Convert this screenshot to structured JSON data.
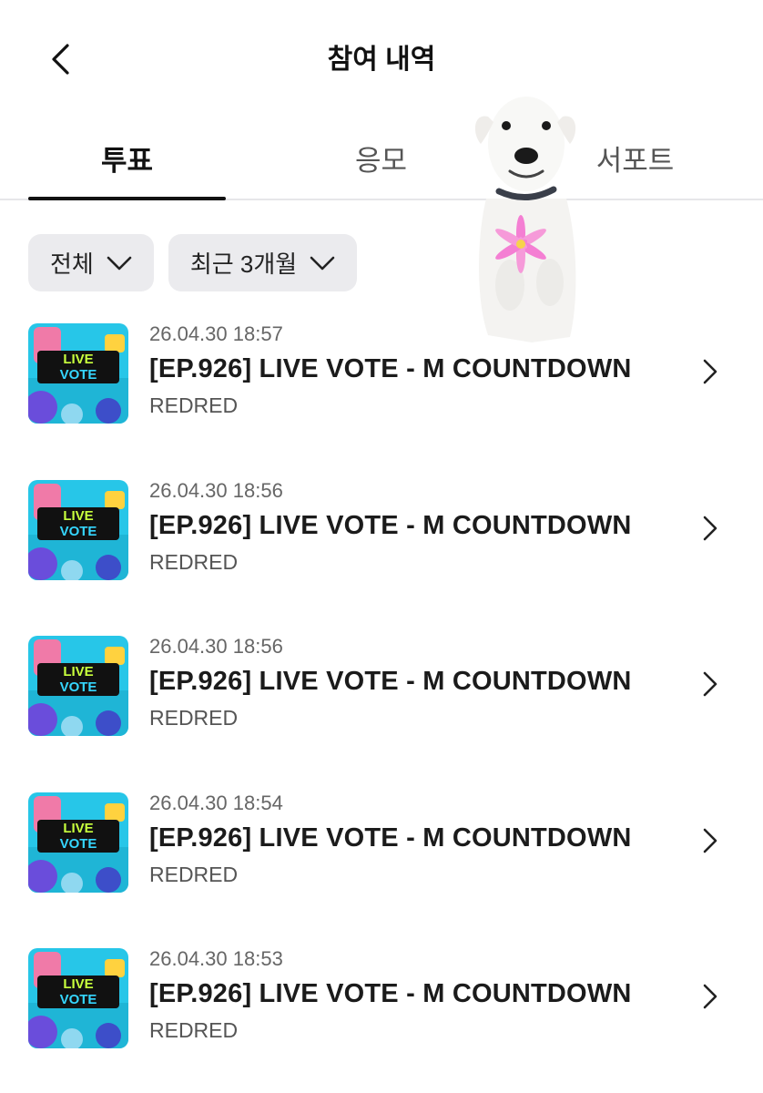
{
  "header": {
    "title": "참여 내역",
    "back_icon": "chevron-left-icon"
  },
  "tabs": [
    {
      "label": "투표",
      "active": true
    },
    {
      "label": "응모",
      "active": false
    },
    {
      "label": "서포트",
      "active": false
    }
  ],
  "filters": [
    {
      "label": "전체",
      "icon": "chevron-down-icon"
    },
    {
      "label": "최근 3개월",
      "icon": "chevron-down-icon"
    }
  ],
  "items": [
    {
      "date": "26.04.30 18:57",
      "title": "[EP.926] LIVE VOTE - M COUNTDOWN",
      "artist": "REDRED",
      "thumb_text_1": "LIVE",
      "thumb_text_2": "VOTE"
    },
    {
      "date": "26.04.30 18:56",
      "title": "[EP.926] LIVE VOTE - M COUNTDOWN",
      "artist": "REDRED",
      "thumb_text_1": "LIVE",
      "thumb_text_2": "VOTE"
    },
    {
      "date": "26.04.30 18:56",
      "title": "[EP.926] LIVE VOTE - M COUNTDOWN",
      "artist": "REDRED",
      "thumb_text_1": "LIVE",
      "thumb_text_2": "VOTE"
    },
    {
      "date": "26.04.30 18:54",
      "title": "[EP.926] LIVE VOTE - M COUNTDOWN",
      "artist": "REDRED",
      "thumb_text_1": "LIVE",
      "thumb_text_2": "VOTE"
    },
    {
      "date": "26.04.30 18:53",
      "title": "[EP.926] LIVE VOTE - M COUNTDOWN",
      "artist": "REDRED",
      "thumb_text_1": "LIVE",
      "thumb_text_2": "VOTE"
    }
  ],
  "colors": {
    "active_tab": "#111111",
    "chip_bg": "#ebebee",
    "divider": "#e6e6e9",
    "thumb_bg": "#27c6e8"
  }
}
